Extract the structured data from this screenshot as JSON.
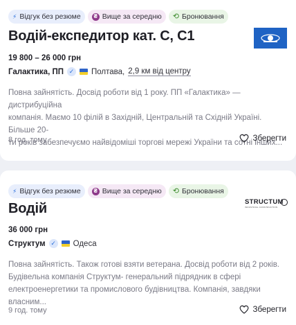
{
  "jobs": [
    {
      "tags": [
        {
          "label": "Відгук без резюме",
          "icon": "bolt-icon"
        },
        {
          "label": "Вище за середню",
          "icon": "salary-coin-icon"
        },
        {
          "label": "Бронювання",
          "icon": "reservation-icon"
        }
      ],
      "title": "Водій-експедитор кат. C, C1",
      "salary": "19 800 – 26 000 грн",
      "company": "Галактика, ПП",
      "city": "Полтава,",
      "distance": "2,9 км від центру",
      "description_lines": [
        "Повна зайнятість. Досвід роботи від 1 року. ПП «Галактика» — дистрибуційна",
        "компанія. Маємо 10 філій в Західній, Центральній та Східній Україні. Більше 20-",
        "ти років забезпечуємо найвідоміші торгові мережі України та сотні інших..."
      ],
      "posted": "8 год. тому",
      "save_label": "Зберегти",
      "logo": "galaktika-logo"
    },
    {
      "tags": [
        {
          "label": "Відгук без резюме",
          "icon": "bolt-icon"
        },
        {
          "label": "Вище за середню",
          "icon": "salary-coin-icon"
        },
        {
          "label": "Бронювання",
          "icon": "reservation-icon"
        }
      ],
      "title": "Водій",
      "salary": "36 000 грн",
      "company": "Структум",
      "city": "Одеса",
      "description_lines": [
        "Повна зайнятість. Також готові взяти ветерана. Досвід роботи від 2 років.",
        "Будівельна компанія Структум- генеральний підрядник в сфері",
        "електроенергетики та промислового будівництва. Компанія, завдяки власним..."
      ],
      "posted": "9 год. тому",
      "save_label": "Зберегти",
      "logo_text": "STRUCTUM",
      "logo_subtext": "INDUSTRIAL CONSTRUCTION"
    }
  ],
  "colors": {
    "page_bg": "#eef0f5",
    "card_bg": "#ffffff",
    "accent_blue": "#2a6fdb",
    "tag_purple": "#8e3a8a",
    "tag_green": "#3a8a2a"
  }
}
